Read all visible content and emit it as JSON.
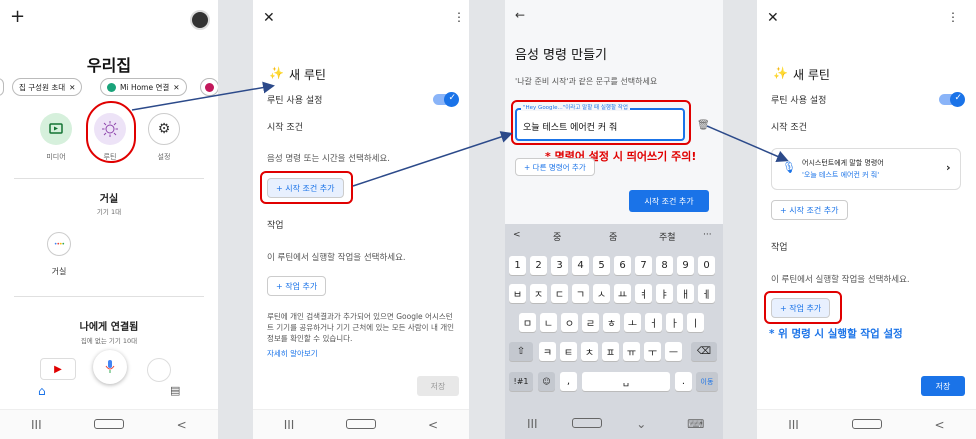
{
  "panel1": {
    "title": "우리집",
    "chips": [
      "집 구성원 초대",
      "Mi Home 연결"
    ],
    "shortcuts": [
      {
        "label": "미디어",
        "icon": "media-icon"
      },
      {
        "label": "루틴",
        "icon": "routine-icon"
      },
      {
        "label": "설정",
        "icon": "settings-icon"
      }
    ],
    "room_title": "거실",
    "room_sub": "기기 1대",
    "device_label": "거실",
    "connected_title": "나에게 연결됨",
    "connected_sub": "집에 없는 기기 10대"
  },
  "panel2": {
    "title": "새 루틴",
    "toggle_label": "루틴 사용 설정",
    "start_condition": "시작 조건",
    "start_hint": "음성 명령 또는 시간을 선택하세요.",
    "add_start_btn": "+ 시작 조건 추가",
    "action_label": "작업",
    "action_hint": "이 루틴에서 실행할 작업을 선택하세요.",
    "add_action_btn": "+ 작업 추가",
    "notice": "루틴에 개인 검색결과가 추가되어 있으면 Google 어시스턴트 기기를 공유하거나 기기 근처에 있는 모든 사람이 내 개인 정보를 확인할 수 있습니다.",
    "learn_more": "자세히 알아보기",
    "save": "저장"
  },
  "panel3": {
    "title": "음성 명령 만들기",
    "hint": "'나갈 준비 시작'과 같은 문구를 선택하세요",
    "field_label": "\"Hey Google...\"이라고 말할 때 실행할 작업",
    "field_value": "오늘 테스트 에어컨 커 줘",
    "add_other": "+ 다른 명령어 추가",
    "add_condition_btn": "시작 조건 추가",
    "annotation": "* 명령어 설정 시 띄어쓰기 주의!",
    "suggestions": [
      "<",
      "중",
      "줌",
      "주철",
      "···"
    ],
    "row_numbers": [
      "1",
      "2",
      "3",
      "4",
      "5",
      "6",
      "7",
      "8",
      "9",
      "0"
    ],
    "row1": [
      "ㅂ",
      "ㅈ",
      "ㄷ",
      "ㄱ",
      "ㅅ",
      "ㅛ",
      "ㅕ",
      "ㅑ",
      "ㅐ",
      "ㅔ"
    ],
    "row2": [
      "ㅁ",
      "ㄴ",
      "ㅇ",
      "ㄹ",
      "ㅎ",
      "ㅗ",
      "ㅓ",
      "ㅏ",
      "ㅣ"
    ],
    "row3": [
      "ㅋ",
      "ㅌ",
      "ㅊ",
      "ㅍ",
      "ㅠ",
      "ㅜ",
      "ㅡ"
    ],
    "key_sym": "!#1",
    "key_dot": ".",
    "key_comma": ",",
    "key_enter": "이동"
  },
  "panel4": {
    "title": "새 루틴",
    "toggle_label": "루틴 사용 설정",
    "start_condition": "시작 조건",
    "cmd_title": "어시스턴트에게 말할 명령어",
    "cmd_value": "'오늘 테스트 에어컨 커 줘'",
    "add_start_btn": "+ 시작 조건 추가",
    "action_label": "작업",
    "action_hint": "이 루틴에서 실행할 작업을 선택하세요.",
    "add_action_btn": "+ 작업 추가",
    "annotation": "* 위 명령 시 실행할 작업 설정",
    "save": "저장"
  },
  "colors": {
    "accent": "#1a73e8",
    "annotation": "#e00000",
    "keyboard_bg": "#d5d8de"
  }
}
